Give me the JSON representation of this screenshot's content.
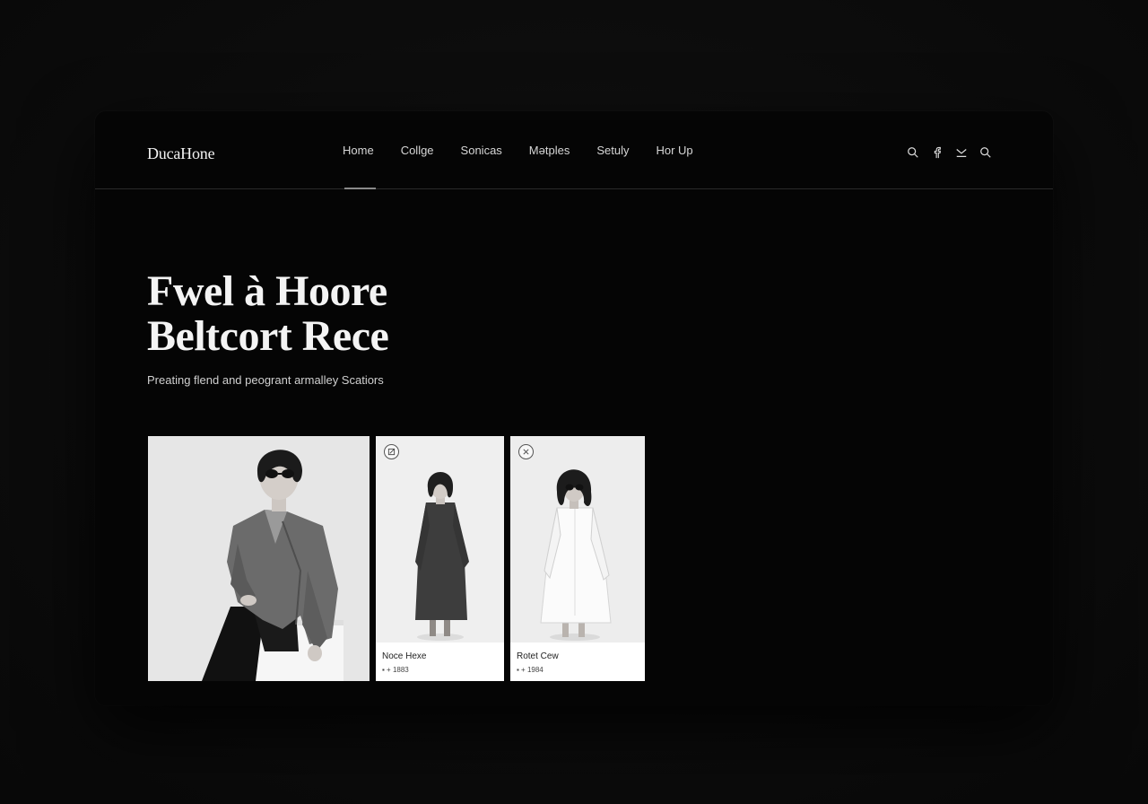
{
  "brand": {
    "name": "DucaHone"
  },
  "nav": {
    "items": [
      {
        "label": "Home",
        "active": true
      },
      {
        "label": "Collge",
        "active": false
      },
      {
        "label": "Sonicas",
        "active": false
      },
      {
        "label": "Mətples",
        "active": false
      },
      {
        "label": "Setuly",
        "active": false
      },
      {
        "label": "Hor Up",
        "active": false
      }
    ],
    "icons": [
      "search-icon",
      "facebook-icon",
      "mail-icon",
      "search-icon"
    ]
  },
  "hero": {
    "title_line1": "Fwel à Hoore",
    "title_line2": "Beltcort Rece",
    "subtitle": "Preating flend and peogrant armalley Scatiors"
  },
  "gallery": {
    "cards": [
      {
        "badge": null,
        "name": null,
        "meta": null
      },
      {
        "badge": "edit-icon",
        "name": "Noce Hexe",
        "meta": "▪ + 1883"
      },
      {
        "badge": "close-icon",
        "name": "Rotet Cew",
        "meta": "▪ + 1984"
      }
    ]
  },
  "colors": {
    "background": "#0d0d0d",
    "window": "#050505",
    "text": "#f4f4f4",
    "divider": "#2a2a2a"
  }
}
